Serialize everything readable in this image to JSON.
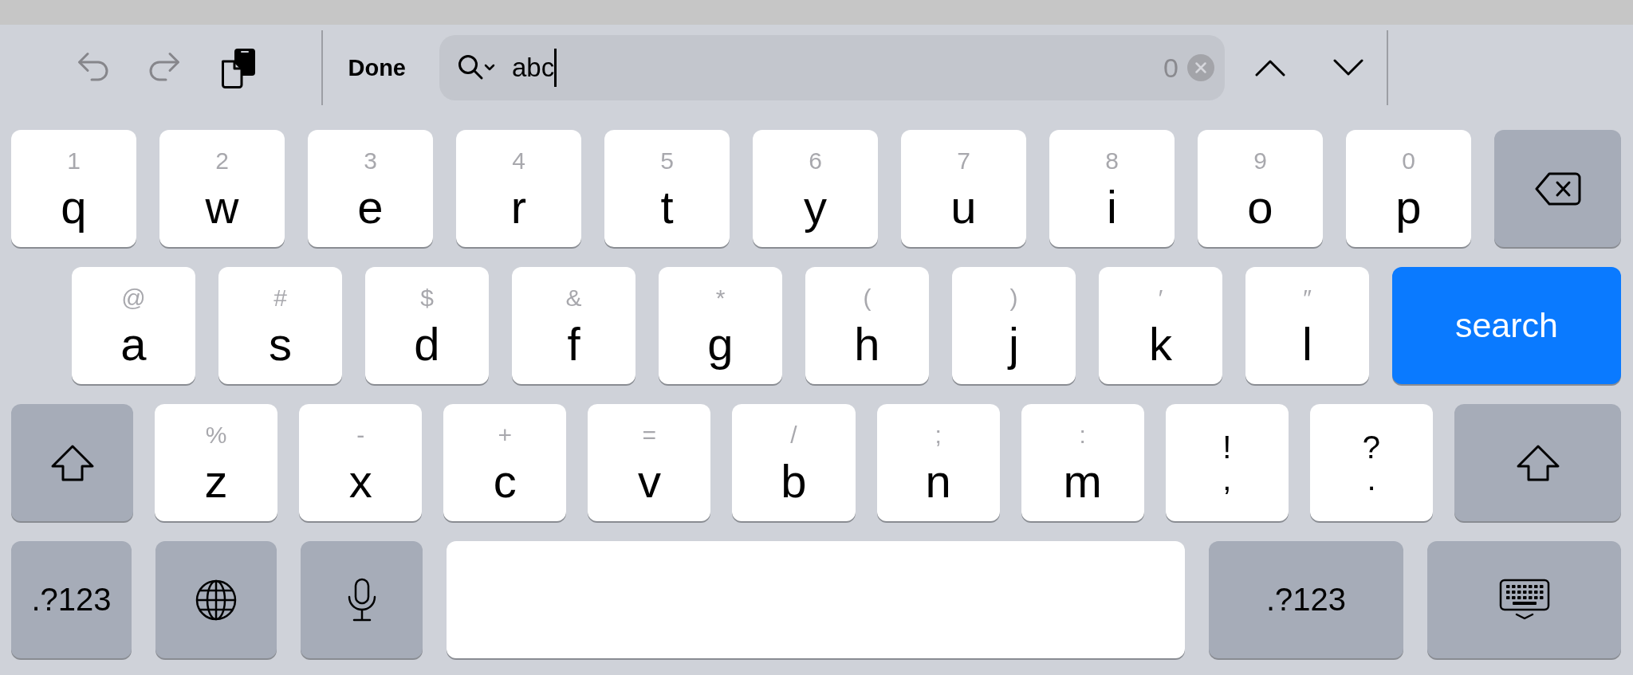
{
  "toolbar": {
    "edit_buttons": [
      {
        "kind": "undo",
        "disabled": true
      },
      {
        "kind": "redo",
        "disabled": true
      },
      {
        "kind": "paste",
        "disabled": false
      }
    ],
    "done_label": "Done",
    "search": {
      "value": "abc",
      "match_count": "0"
    },
    "nav_buttons": [
      {
        "kind": "previous",
        "disabled": false
      },
      {
        "kind": "next",
        "disabled": false
      }
    ]
  },
  "keyboard": {
    "rows": [
      {
        "keys": [
          {
            "kind": "letter",
            "label": "q",
            "hint": "1"
          },
          {
            "kind": "letter",
            "label": "w",
            "hint": "2"
          },
          {
            "kind": "letter",
            "label": "e",
            "hint": "3"
          },
          {
            "kind": "letter",
            "label": "r",
            "hint": "4"
          },
          {
            "kind": "letter",
            "label": "t",
            "hint": "5"
          },
          {
            "kind": "letter",
            "label": "y",
            "hint": "6"
          },
          {
            "kind": "letter",
            "label": "u",
            "hint": "7"
          },
          {
            "kind": "letter",
            "label": "i",
            "hint": "8"
          },
          {
            "kind": "letter",
            "label": "o",
            "hint": "9"
          },
          {
            "kind": "letter",
            "label": "p",
            "hint": "0"
          },
          {
            "kind": "backspace"
          }
        ]
      },
      {
        "keys": [
          {
            "kind": "letter",
            "label": "a",
            "hint": "@"
          },
          {
            "kind": "letter",
            "label": "s",
            "hint": "#"
          },
          {
            "kind": "letter",
            "label": "d",
            "hint": "$"
          },
          {
            "kind": "letter",
            "label": "f",
            "hint": "&"
          },
          {
            "kind": "letter",
            "label": "g",
            "hint": "*"
          },
          {
            "kind": "letter",
            "label": "h",
            "hint": "("
          },
          {
            "kind": "letter",
            "label": "j",
            "hint": ")"
          },
          {
            "kind": "letter",
            "label": "k",
            "hint": "′"
          },
          {
            "kind": "letter",
            "label": "l",
            "hint": "″"
          },
          {
            "kind": "return",
            "label": "search"
          }
        ]
      },
      {
        "keys": [
          {
            "kind": "shift",
            "on": false
          },
          {
            "kind": "letter",
            "label": "z",
            "hint": "%"
          },
          {
            "kind": "letter",
            "label": "x",
            "hint": "-"
          },
          {
            "kind": "letter",
            "label": "c",
            "hint": "+"
          },
          {
            "kind": "letter",
            "label": "v",
            "hint": "="
          },
          {
            "kind": "letter",
            "label": "b",
            "hint": "/"
          },
          {
            "kind": "letter",
            "label": "n",
            "hint": ";"
          },
          {
            "kind": "letter",
            "label": "m",
            "hint": ":"
          },
          {
            "kind": "punctuation",
            "top": "!",
            "label": ","
          },
          {
            "kind": "punctuation",
            "top": "?",
            "label": "."
          },
          {
            "kind": "shift",
            "on": false
          }
        ]
      },
      {
        "keys": [
          {
            "kind": "mode",
            "label": ".?123"
          },
          {
            "kind": "globe"
          },
          {
            "kind": "microphone"
          },
          {
            "kind": "space"
          },
          {
            "kind": "mode",
            "label": ".?123"
          },
          {
            "kind": "dismiss"
          }
        ]
      }
    ]
  }
}
